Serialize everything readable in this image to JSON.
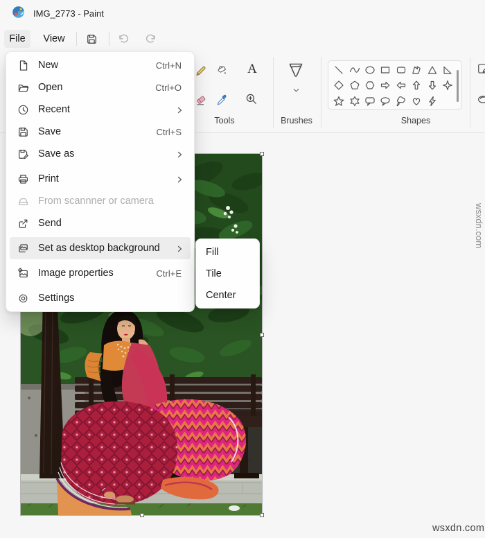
{
  "window": {
    "title": "IMG_2773 - Paint"
  },
  "menubar": {
    "file_label": "File",
    "view_label": "View"
  },
  "file_menu": {
    "items": [
      {
        "label": "New",
        "shortcut": "Ctrl+N"
      },
      {
        "label": "Open",
        "shortcut": "Ctrl+O"
      },
      {
        "label": "Recent",
        "has_submenu": true
      },
      {
        "label": "Save",
        "shortcut": "Ctrl+S"
      },
      {
        "label": "Save as",
        "has_submenu": true
      },
      {
        "label": "Print",
        "has_submenu": true
      },
      {
        "label": "From scannner or camera",
        "disabled": true
      },
      {
        "label": "Send"
      },
      {
        "label": "Set as desktop background",
        "has_submenu": true,
        "highlighted": true
      },
      {
        "label": "Image properties",
        "shortcut": "Ctrl+E"
      },
      {
        "label": "Settings"
      }
    ]
  },
  "desktop_background_submenu": {
    "items": [
      {
        "label": "Fill"
      },
      {
        "label": "Tile"
      },
      {
        "label": "Center"
      }
    ]
  },
  "ribbon": {
    "tools_label": "Tools",
    "brushes_label": "Brushes",
    "shapes_label": "Shapes",
    "text_tool_glyph": "A",
    "shapes": [
      "line",
      "curve",
      "oval",
      "rectangle",
      "rounded-rectangle",
      "polygon",
      "triangle",
      "right-triangle",
      "diamond",
      "pentagon",
      "hexagon",
      "arrow-right",
      "arrow-left",
      "arrow-up",
      "arrow-down",
      "four-point-star",
      "five-point-star",
      "six-point-star",
      "rounded-callout",
      "oval-callout",
      "cloud-callout",
      "heart",
      "lightning"
    ]
  },
  "watermarks": {
    "bottom_right": "wsxdn.com",
    "right_side": "wsxdn.com"
  },
  "colors": {
    "menu_highlight": "#ededed",
    "saree_pink": "#df2580",
    "saree_red": "#ab1f3c",
    "blouse_orange": "#e08a38",
    "bench_brown": "#2e1d18"
  }
}
